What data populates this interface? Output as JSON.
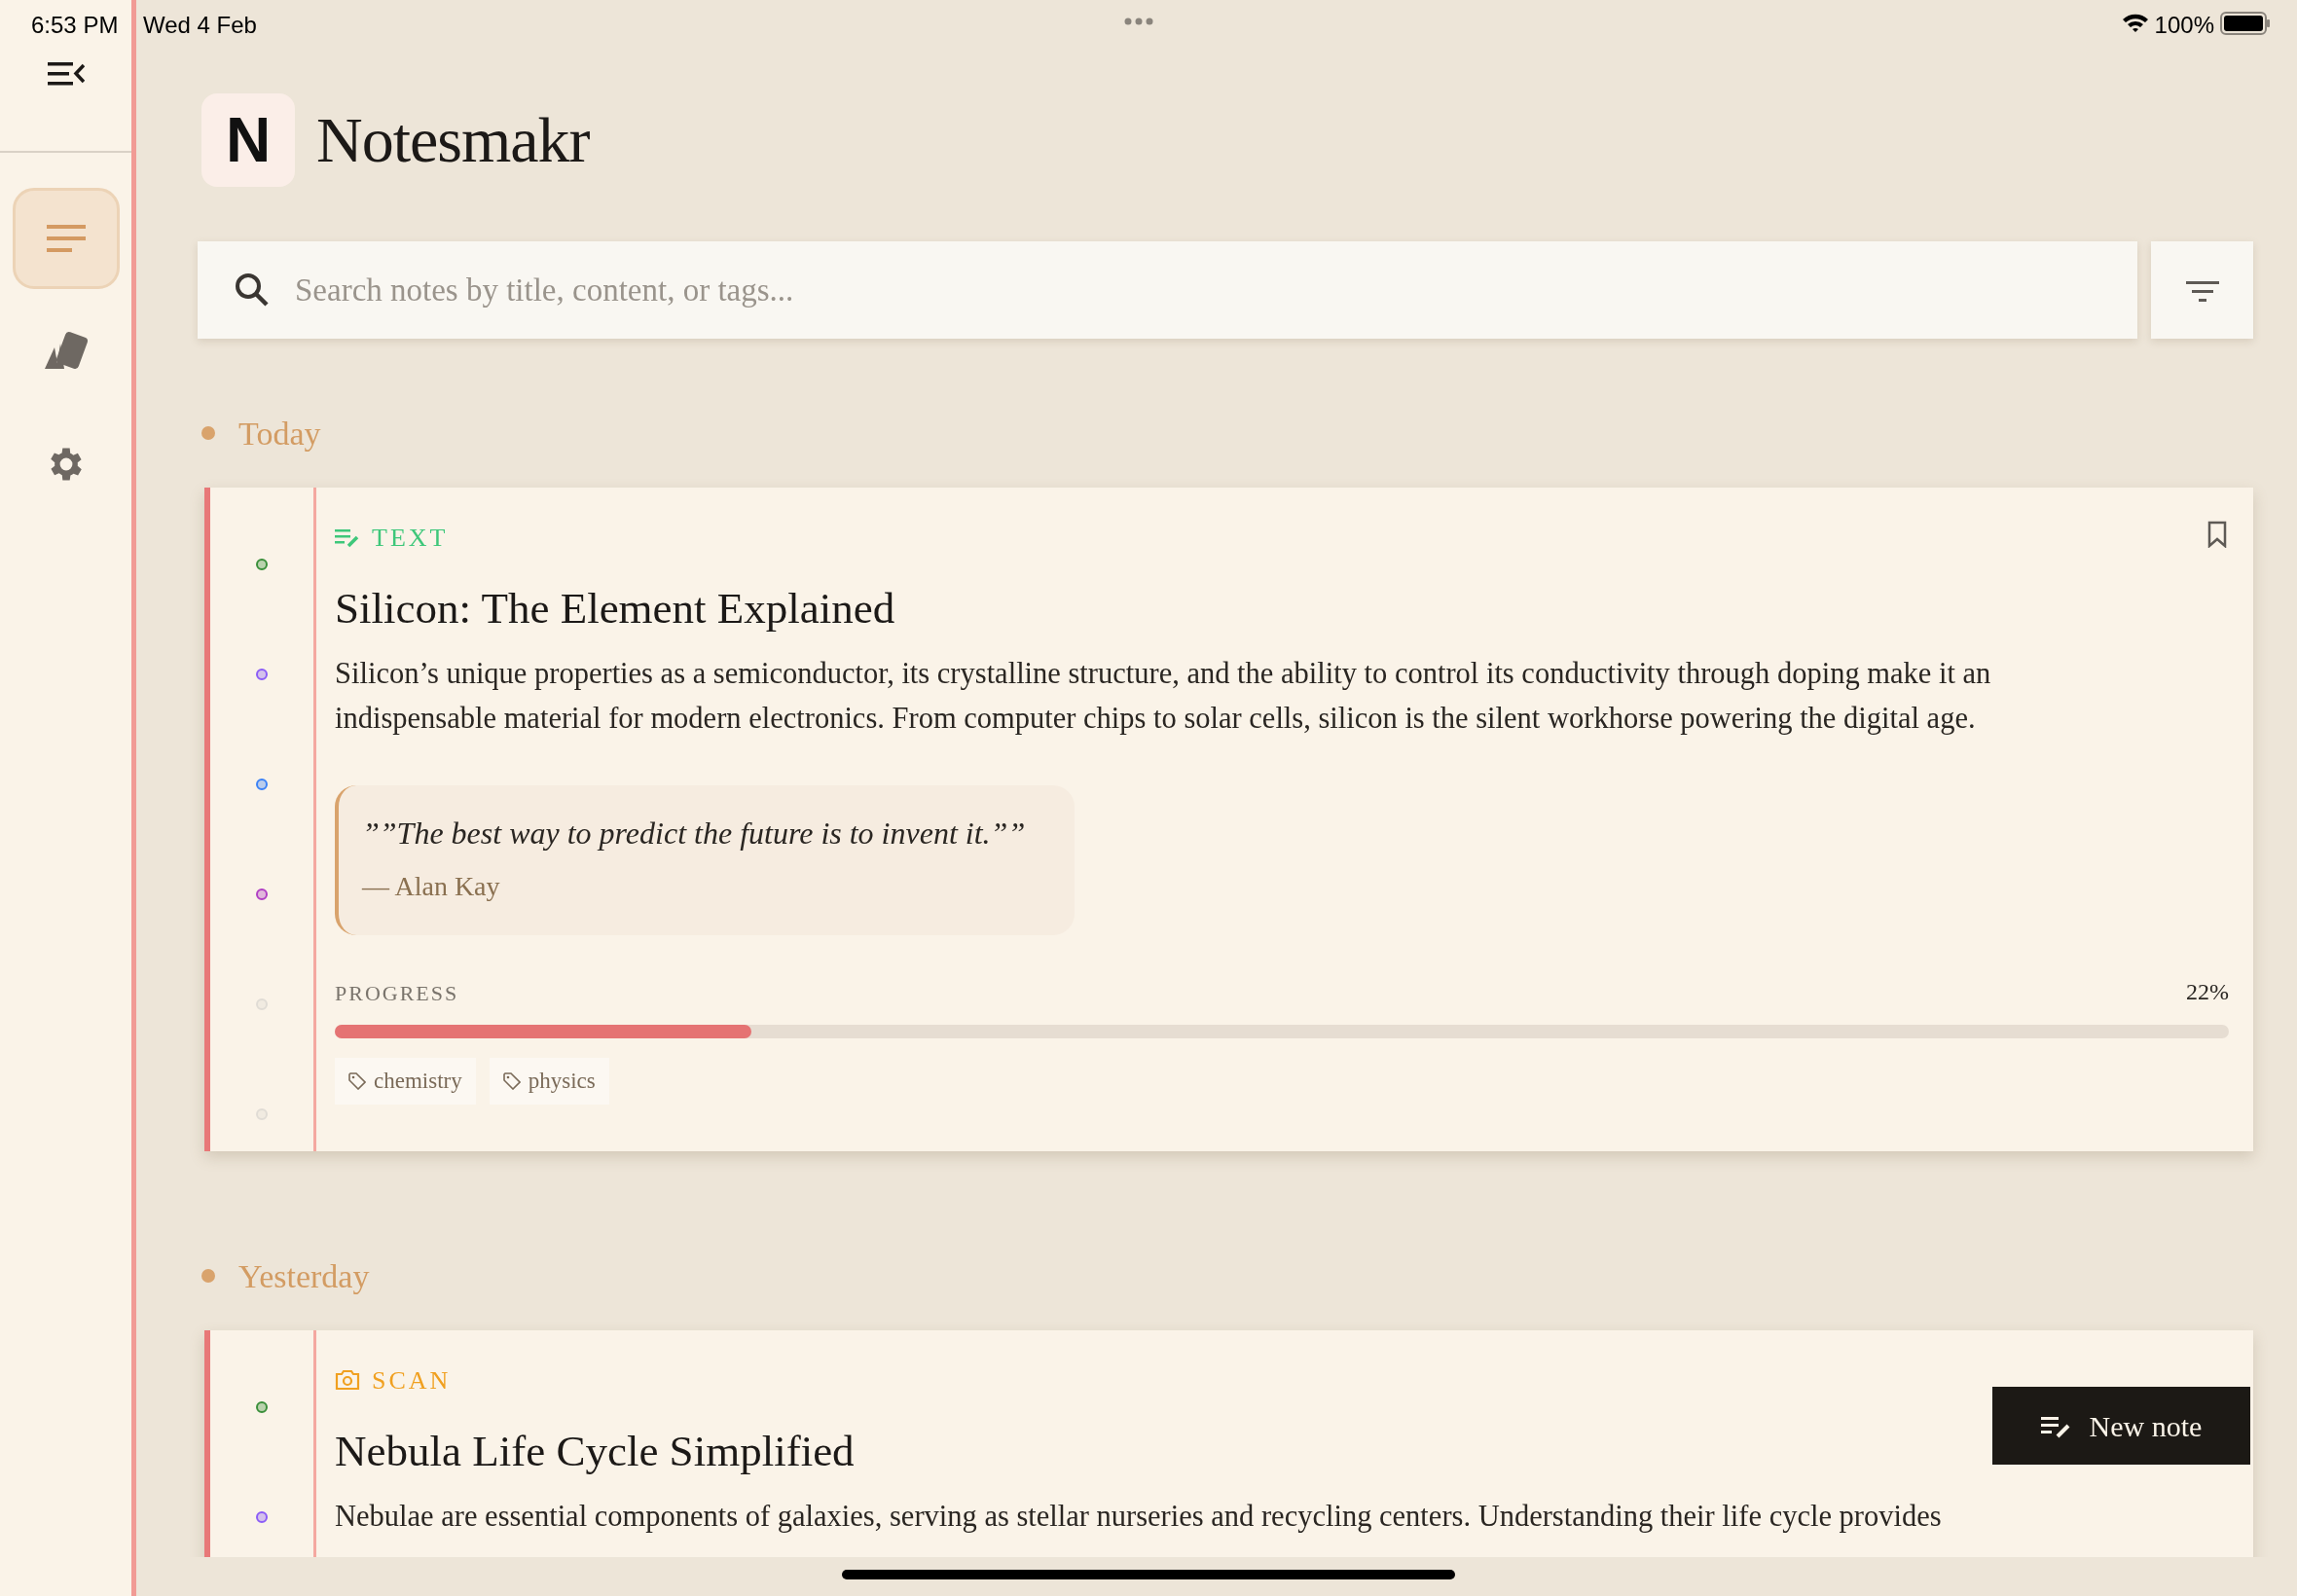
{
  "status_bar": {
    "time": "6:53 PM",
    "date": "Wed 4 Feb",
    "battery": "100%"
  },
  "app": {
    "logo_letter": "N",
    "title": "Notesmakr"
  },
  "sidebar": {
    "items": [
      {
        "kind": "notes",
        "selected": true
      },
      {
        "kind": "cards",
        "selected": false
      },
      {
        "kind": "settings",
        "selected": false
      }
    ]
  },
  "search": {
    "placeholder": "Search notes by title, content, or tags..."
  },
  "sections": [
    {
      "heading": "Today",
      "notes": [
        {
          "kind": "text",
          "type_label": "TEXT",
          "bookmarked": false,
          "title": "Silicon: The Element Explained",
          "body": "Silicon’s unique properties as a semiconductor, its crystalline structure, and the ability to control its conductivity through doping make it an indispensable material for modern electronics. From computer chips to solar cells, silicon is the silent workhorse powering the digital age.",
          "quote": {
            "text": "””The best way to predict the future is to invent it.””",
            "author": "— Alan Kay"
          },
          "progress": {
            "label": "PROGRESS",
            "reading": "22%",
            "level": 0.22
          },
          "tags": [
            "chemistry",
            "physics"
          ],
          "dots": [
            {
              "color": "#3a8f3a"
            },
            {
              "color": "#8b5cf6"
            },
            {
              "color": "#3b82f6"
            },
            {
              "color": "#b03fc4"
            },
            {
              "color": "#e0dcd5"
            },
            {
              "color": "#e0dcd5"
            }
          ]
        }
      ]
    },
    {
      "heading": "Yesterday",
      "notes": [
        {
          "kind": "scan",
          "type_label": "SCAN",
          "title": "Nebula Life Cycle Simplified",
          "body": "Nebulae are essential components of galaxies, serving as stellar nurseries and recycling centers. Understanding their life cycle provides",
          "dots": [
            {
              "color": "#3a8f3a"
            },
            {
              "color": "#8b5cf6"
            }
          ]
        }
      ]
    }
  ],
  "fab": {
    "label": "New note"
  }
}
